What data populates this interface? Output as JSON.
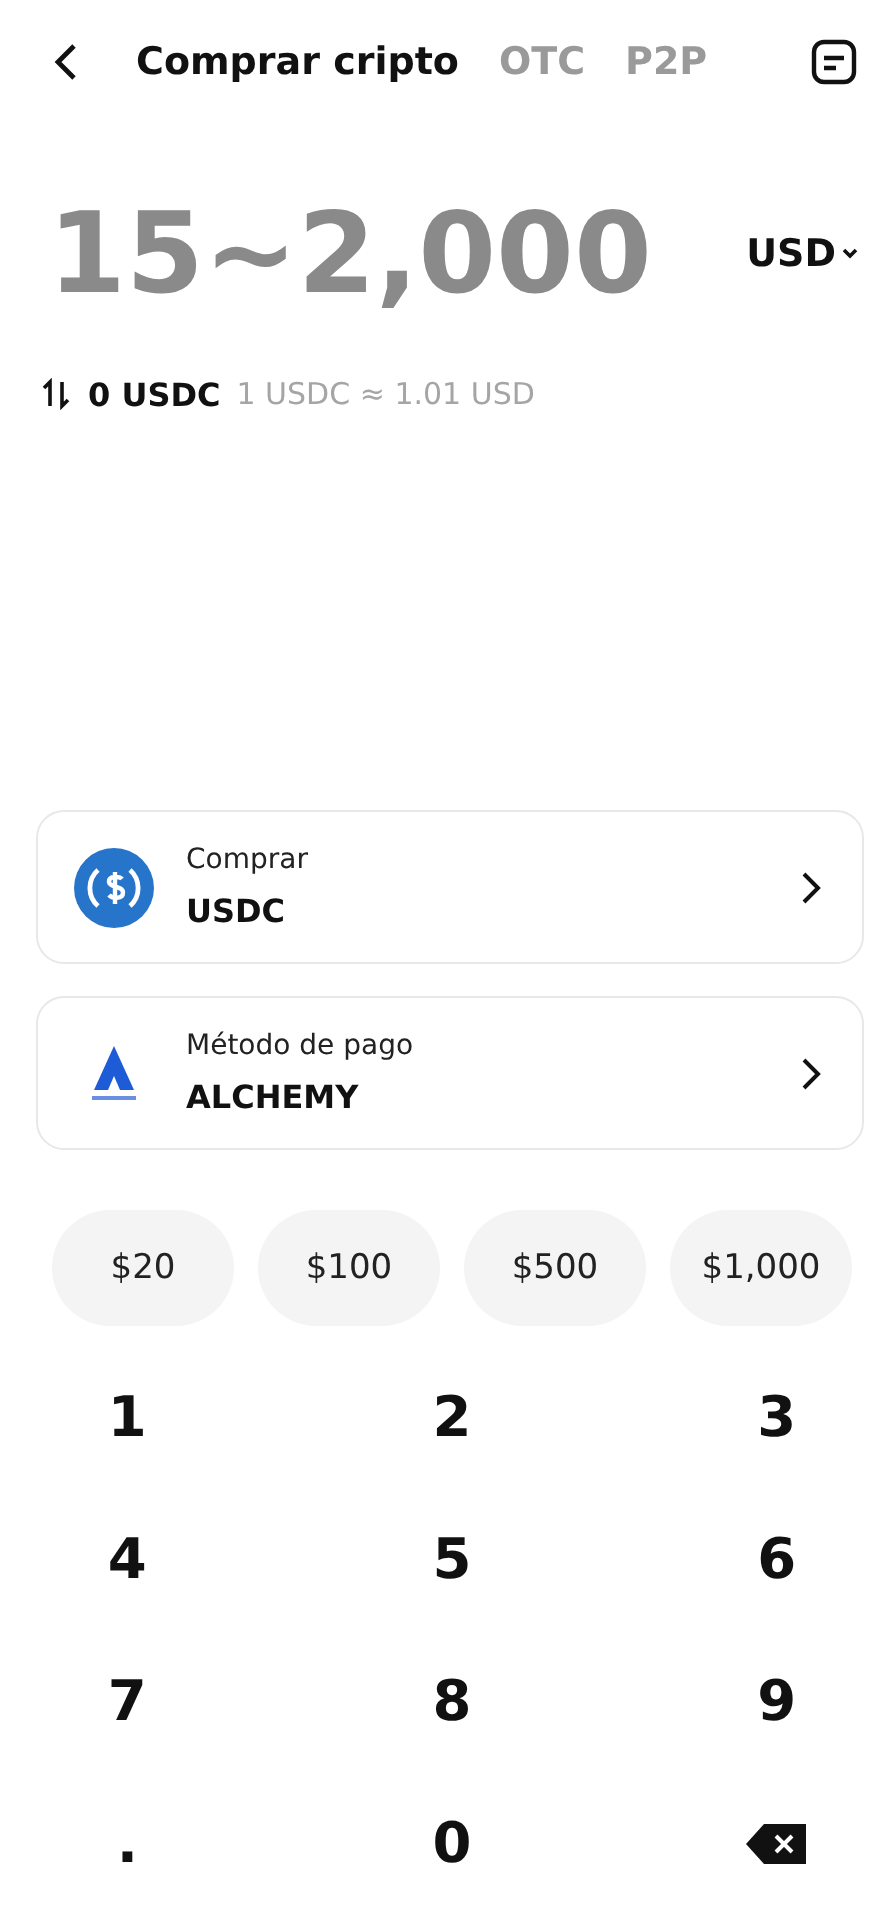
{
  "tabs": [
    {
      "label": "Comprar cripto",
      "selected": true
    },
    {
      "label": "OTC",
      "selected": false
    },
    {
      "label": "P2P",
      "selected": false
    }
  ],
  "amount": {
    "placeholder": "15~2,000",
    "currency": "USD"
  },
  "conversion": {
    "value": "0 USDC",
    "rate": "1 USDC ≈ 1.01 USD"
  },
  "selectors": [
    {
      "kind": "coin",
      "label": "Comprar",
      "value": "USDC"
    },
    {
      "kind": "payment",
      "label": "Método de pago",
      "value": "ALCHEMY"
    }
  ],
  "presets": [
    "$20",
    "$100",
    "$500",
    "$1,000"
  ],
  "keys": [
    {
      "kind": "digit",
      "label": "1"
    },
    {
      "kind": "digit",
      "label": "2"
    },
    {
      "kind": "digit",
      "label": "3"
    },
    {
      "kind": "digit",
      "label": "4"
    },
    {
      "kind": "digit",
      "label": "5"
    },
    {
      "kind": "digit",
      "label": "6"
    },
    {
      "kind": "digit",
      "label": "7"
    },
    {
      "kind": "digit",
      "label": "8"
    },
    {
      "kind": "digit",
      "label": "9"
    },
    {
      "kind": "digit",
      "label": "."
    },
    {
      "kind": "digit",
      "label": "0"
    },
    {
      "kind": "backspace"
    }
  ]
}
